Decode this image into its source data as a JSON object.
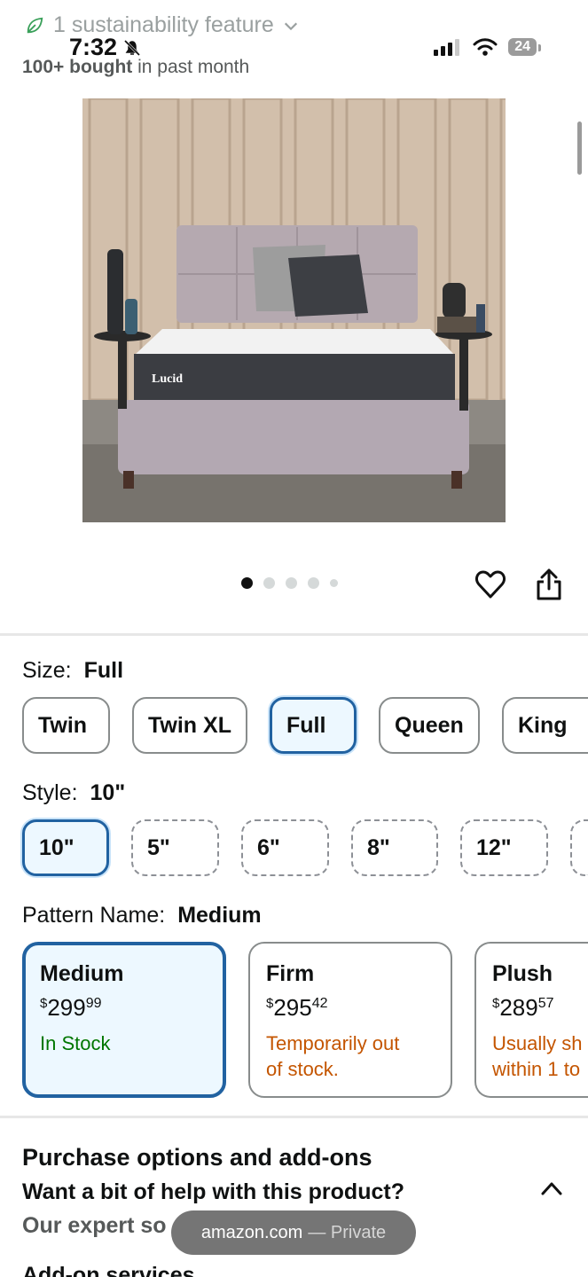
{
  "status_bar": {
    "time": "7:32",
    "battery": "24"
  },
  "sustainability": {
    "text": "1 sustainability feature"
  },
  "social_proof": {
    "count": "100+ bought",
    "suffix": "in past month"
  },
  "product_image": {
    "brand_label": "Lucid",
    "alt": "Lucid mattress on upholstered bed"
  },
  "carousel": {
    "total": 5,
    "active_index": 0
  },
  "size": {
    "label": "Size:",
    "selected": "Full",
    "options": [
      "Twin",
      "Twin XL",
      "Full",
      "Queen",
      "King"
    ]
  },
  "style": {
    "label": "Style:",
    "selected": "10\"",
    "options": [
      "10\"",
      "5\"",
      "6\"",
      "8\"",
      "12\""
    ]
  },
  "pattern": {
    "label": "Pattern Name:",
    "selected": "Medium",
    "options": [
      {
        "name": "Medium",
        "currency": "$",
        "dollars": "299",
        "cents": "99",
        "availability_1": "In Stock",
        "availability_2": ""
      },
      {
        "name": "Firm",
        "currency": "$",
        "dollars": "295",
        "cents": "42",
        "availability_1": "Temporarily out",
        "availability_2": "of stock."
      },
      {
        "name": "Plush",
        "currency": "$",
        "dollars": "289",
        "cents": "57",
        "availability_1": "Usually sh",
        "availability_2": "within 1 to"
      }
    ]
  },
  "purchase": {
    "title": "Purchase options and add-ons",
    "help_text": "Want a bit of help with this product?",
    "expert_text": "Our expert so",
    "addon_text": "Add-on services"
  },
  "browser_pill": {
    "domain": "amazon.com",
    "mode": "— Private"
  },
  "colors": {
    "selected_border": "#2162a1",
    "selected_bg": "#edf8ff",
    "in_stock": "#007600",
    "out_of_stock": "#c45500"
  }
}
